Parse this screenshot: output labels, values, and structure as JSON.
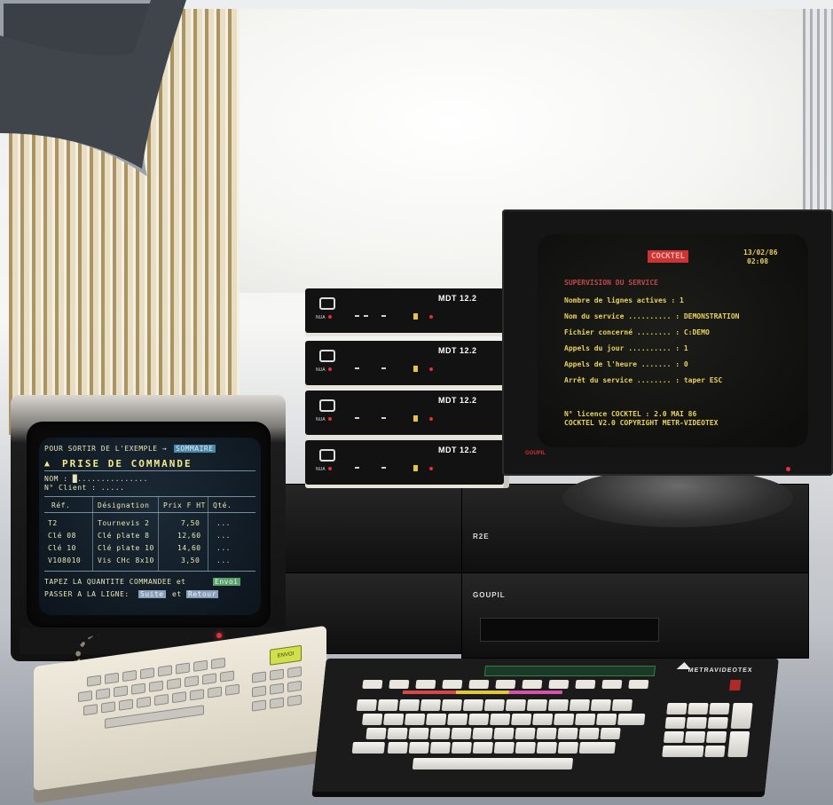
{
  "left_terminal": {
    "header_prompt": "POUR SORTIR DE L'EXEMPLE →",
    "header_key": "SOMMAIRE",
    "title": "PRISE DE COMMANDE",
    "nom_label": "NOM : █...............",
    "client_label": "N° Client : .....",
    "columns": [
      "Réf.",
      "Désignation",
      "Prix F HT",
      "Qté."
    ],
    "rows": [
      {
        "ref": "T2",
        "designation": "Tournevis 2",
        "prix": "7,50",
        "qte": "..."
      },
      {
        "ref": "Clé 08",
        "designation": "Clé plate 8",
        "prix": "12,60",
        "qte": "..."
      },
      {
        "ref": "Clé 10",
        "designation": "Clé plate 10",
        "prix": "14,60",
        "qte": "..."
      },
      {
        "ref": "V108010",
        "designation": "Vis CHc 8x10",
        "prix": "3,50",
        "qte": "..."
      }
    ],
    "footer_line1": "TAPEZ LA QUANTITE COMMANDEE et",
    "footer_btn1": "Envoi",
    "footer_line2": "PASSER A LA LIGNE:",
    "footer_btn2": "Suite",
    "footer_and": "et",
    "footer_btn3": "Retour"
  },
  "keypad": {
    "green_key": "ENVOI"
  },
  "modems": [
    {
      "model": "MDT 12.2",
      "tag": "NUA"
    },
    {
      "model": "MDT 12.2",
      "tag": "NUA"
    },
    {
      "model": "MDT 12.2",
      "tag": "NUA"
    },
    {
      "model": "MDT 12.2",
      "tag": "NUA"
    }
  ],
  "units": {
    "upper_brand": "R2E",
    "lower_brand": "GOUPIL"
  },
  "right_monitor": {
    "red_box": "COCKTEL",
    "date": "13/02/86",
    "time": "02:08",
    "title": "SUPERVISION DU SERVICE",
    "lines": [
      "Nombre de lignes actives : 1",
      "Nom du service .......... : DEMONSTRATION",
      "Fichier concerné ........ : C:DEMO",
      "Appels du jour .......... : 1",
      "Appels de l'heure ....... : 0",
      "Arrêt du service ........ : taper ESC"
    ],
    "footer1": "N° licence COCKTEL : 2.0 MAI 86",
    "footer2": "COCKTEL V2.0 COPYRIGHT METR-VIDEOTEX",
    "bezel_label": "GOUPIL"
  },
  "keyboard": {
    "brand": "METRAVIDEOTEX"
  }
}
